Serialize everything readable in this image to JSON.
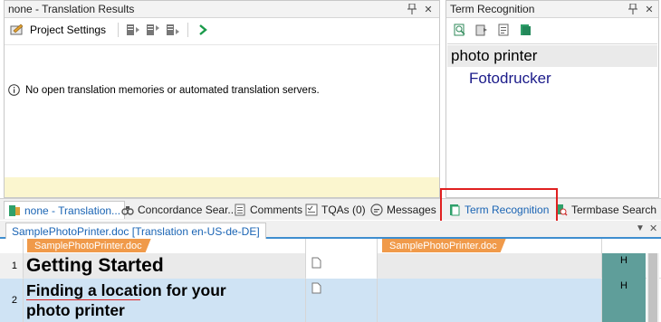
{
  "translation_results": {
    "title": "none - Translation Results",
    "toolbar": {
      "project_settings_label": "Project Settings"
    },
    "message": "No open translation memories or automated translation servers."
  },
  "term_recognition": {
    "title": "Term Recognition",
    "source_term": "photo printer",
    "target_term": "Fotodrucker"
  },
  "tabs": [
    {
      "label": "none - Translation..."
    },
    {
      "label": "Concordance Sear..."
    },
    {
      "label": "Comments"
    },
    {
      "label": "TQAs (0)"
    },
    {
      "label": "Messages"
    },
    {
      "label": "Term Recognition"
    },
    {
      "label": "Termbase Search"
    }
  ],
  "editor": {
    "doc_tab": "SamplePhotoPrinter.doc [Translation en-US-de-DE]",
    "source_file_tag": "SamplePhotoPrinter.doc",
    "target_file_tag": "SamplePhotoPrinter.doc",
    "rows": [
      {
        "num": "1",
        "source": "Getting Started",
        "status": "H"
      },
      {
        "num": "2",
        "source_line1": "Finding a location for your",
        "source_line2": "photo printer",
        "status": "H"
      }
    ]
  },
  "colors": {
    "highlight_box": "#e02020",
    "status_cell": "#5f9e9a",
    "row_selected": "#cfe3f4",
    "yellow_strip": "#fbf6cf",
    "file_tag": "#f09a4a"
  },
  "icons": {
    "pin": "pin-icon",
    "close": "close-icon",
    "info": "info-icon"
  }
}
